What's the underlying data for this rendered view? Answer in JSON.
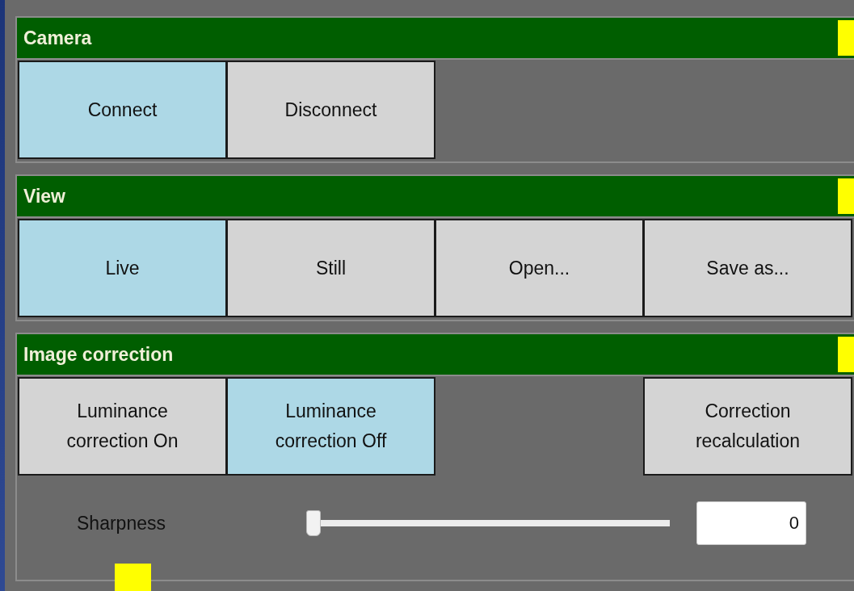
{
  "sections": [
    {
      "title": "Camera",
      "buttons": [
        {
          "kind": "button",
          "label": "Connect",
          "selected": true
        },
        {
          "kind": "button",
          "label": "Disconnect",
          "selected": false
        }
      ]
    },
    {
      "title": "View",
      "buttons": [
        {
          "kind": "button",
          "label": "Live",
          "selected": true
        },
        {
          "kind": "button",
          "label": "Still",
          "selected": false
        },
        {
          "kind": "button",
          "label": "Open...",
          "selected": false
        },
        {
          "kind": "button",
          "label": "Save as...",
          "selected": false
        }
      ]
    },
    {
      "title": "Image correction",
      "buttons": [
        {
          "kind": "button",
          "label": "Luminance correction On",
          "selected": false
        },
        {
          "kind": "button",
          "label": "Luminance correction Off",
          "selected": true
        },
        {
          "kind": "empty"
        },
        {
          "kind": "button",
          "label": "Correction recalculation",
          "selected": false
        }
      ],
      "slider": {
        "label": "Sharpness",
        "level": 0,
        "value": "0"
      }
    }
  ]
}
